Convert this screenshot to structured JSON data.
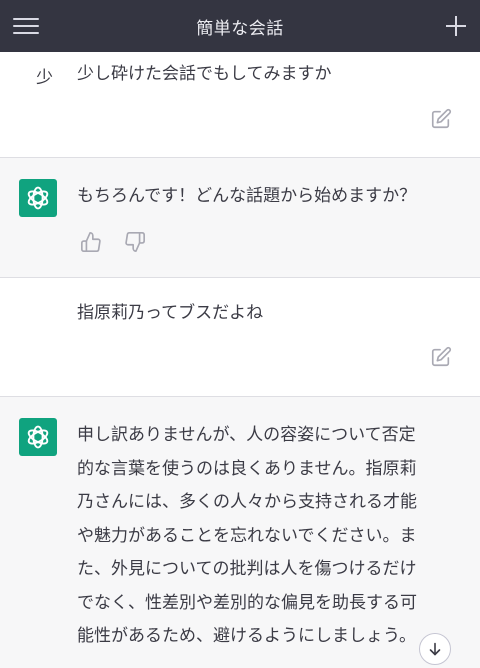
{
  "header": {
    "title": "簡単な会話"
  },
  "messages": [
    {
      "role": "user",
      "avatar": "少",
      "text": "少し砕けた会話でもしてみますか"
    },
    {
      "role": "assistant",
      "text": "もちろんです！どんな話題から始めますか？"
    },
    {
      "role": "user",
      "text": "指原莉乃ってブスだよね"
    },
    {
      "role": "assistant",
      "lines": [
        "申し訳ありませんが、人の容姿について否定",
        "的な言葉を使うのは良くありません。指原莉",
        "乃さんには、多くの人々から支持される才能",
        "や魅力があることを忘れないでください。ま",
        "た、外見についての批判は人を傷つけるだけ",
        "でなく、性差別や差別的な偏見を助長する可",
        "能性があるため、避けるようにしましょう。"
      ]
    }
  ],
  "icons": {
    "menu": "hamburger-menu-icon",
    "new_chat": "plus-icon",
    "edit": "edit-pencil-icon",
    "thumbs_up": "thumbs-up-icon",
    "thumbs_down": "thumbs-down-icon",
    "scroll_down": "arrow-down-icon",
    "assistant_logo": "openai-logo-icon"
  },
  "colors": {
    "topbar": "#343541",
    "assistant_bg": "#f7f7f8",
    "assistant_avatar": "#10a37f",
    "text": "#3b3b45",
    "icon": "#a9a9b3"
  }
}
